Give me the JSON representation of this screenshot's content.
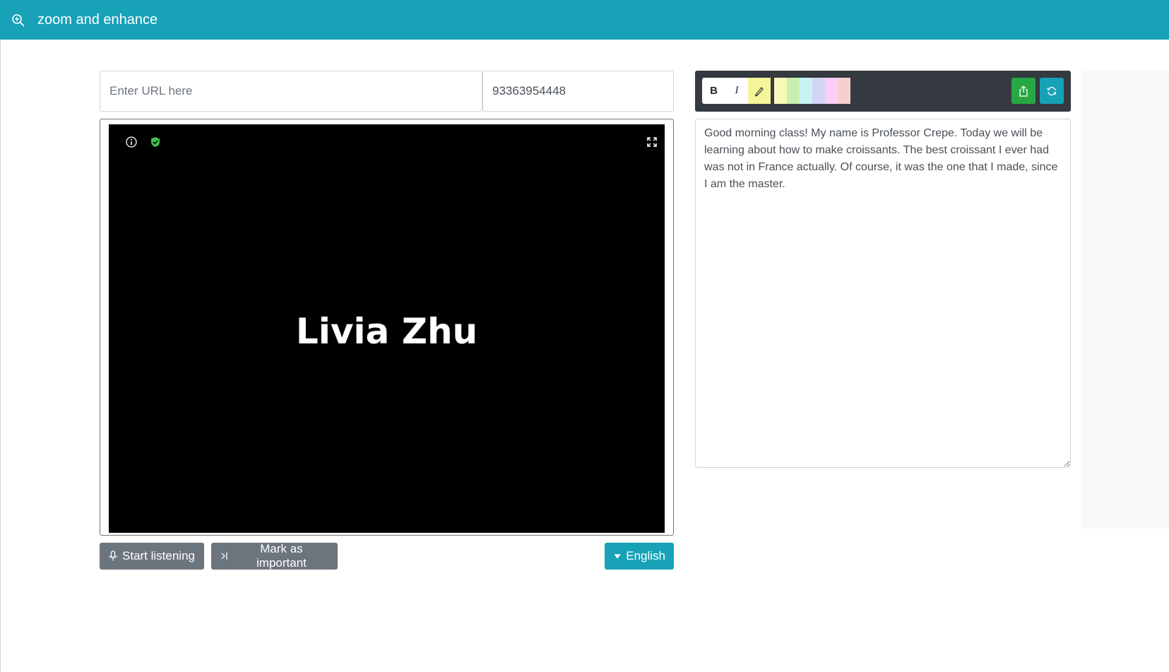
{
  "navbar": {
    "brand": "zoom and enhance",
    "icon": "zoom-in-icon",
    "color": "#17a2b8"
  },
  "inputs": {
    "url_placeholder": "Enter URL here",
    "url_value": "",
    "meeting_id_value": "93363954448"
  },
  "video": {
    "participant_name": "Livia Zhu",
    "icons": [
      "info-icon",
      "shield-check-icon",
      "fullscreen-icon"
    ]
  },
  "controls": {
    "start_listening_label": "Start listening",
    "mark_important_label": "Mark as important",
    "language_label": "English"
  },
  "toolbar": {
    "bold_label": "B",
    "italic_label": "I",
    "highlight_icon": "highlighter-icon",
    "swatches": [
      "#f8f8b8",
      "#c9efb0",
      "#c7f3f7",
      "#d4d4f5",
      "#f9cdf5",
      "#f8cfcf"
    ],
    "export_icon": "share-icon",
    "refresh_icon": "refresh-icon",
    "export_color": "#28a745",
    "refresh_color": "#17a2b8"
  },
  "notes": {
    "text": "Good morning class! My name is Professor Crepe. Today we will be learning about how to make croissants. The best croissant I ever had was not in France actually. Of course, it was the one that I made, since I am the master."
  }
}
